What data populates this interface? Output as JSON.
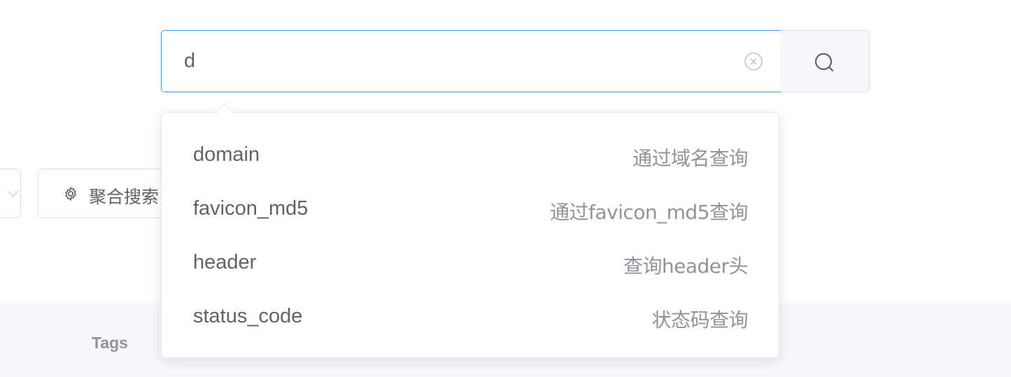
{
  "search": {
    "value": "d",
    "clear_icon": "circle-close-icon",
    "button_icon": "search-icon",
    "focus_color": "#409eff"
  },
  "suggestions": [
    {
      "key": "domain",
      "desc": "通过域名查询"
    },
    {
      "key": "favicon_md5",
      "desc": "通过favicon_md5查询"
    },
    {
      "key": "header",
      "desc": "查询header头"
    },
    {
      "key": "status_code",
      "desc": "状态码查询"
    }
  ],
  "toolbar": {
    "aggregate_label": "聚合搜索",
    "aggregate_icon": "gear-icon"
  },
  "table": {
    "columns": [
      "Tags"
    ]
  }
}
